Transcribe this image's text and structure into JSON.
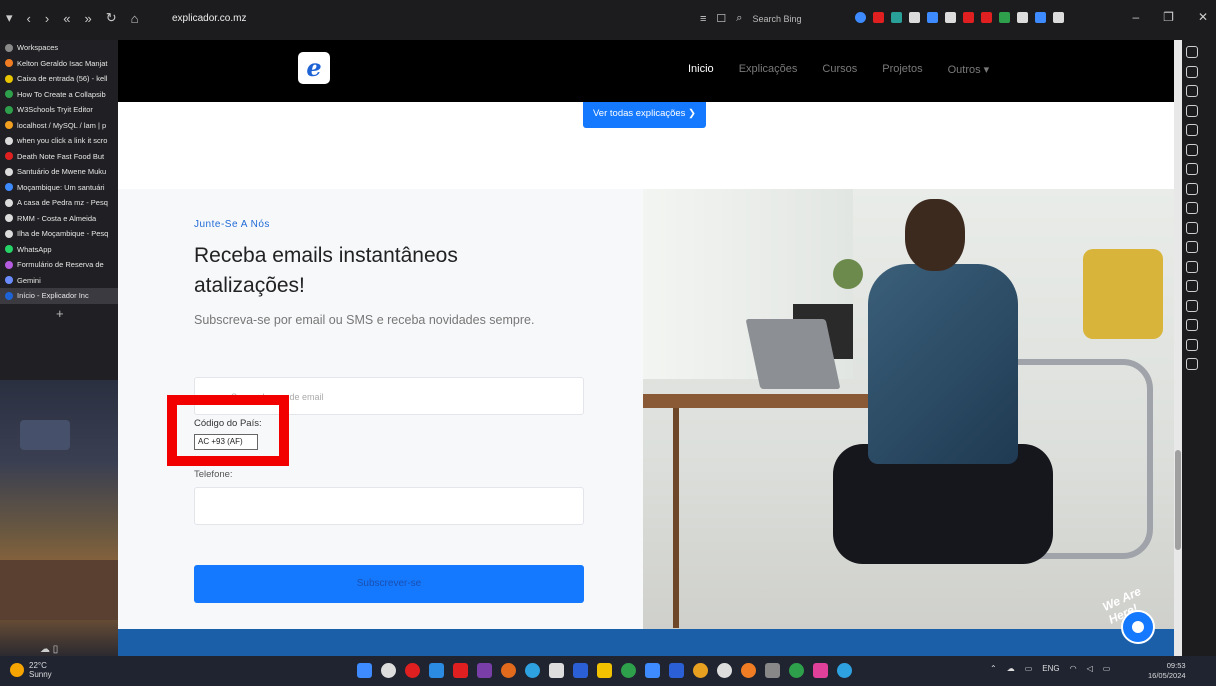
{
  "browser": {
    "url": "explicador.co.mz",
    "search_placeholder": "Search Bing"
  },
  "sidebar": {
    "items": [
      {
        "label": "Workspaces",
        "color": "#8a8a8a"
      },
      {
        "label": "Kelton Geraldo Isac Manjat",
        "color": "#f07d23"
      },
      {
        "label": "Caixa de entrada (56) - kell",
        "color": "#e8c500"
      },
      {
        "label": "How To Create a Collapsib",
        "color": "#2e9f4b"
      },
      {
        "label": "W3Schools Tryit Editor",
        "color": "#2e9f4b"
      },
      {
        "label": "localhost / MySQL / lam | p",
        "color": "#f3a020"
      },
      {
        "label": "when you click a link it scro",
        "color": "#dcdcdc"
      },
      {
        "label": "Death Note Fast Food But",
        "color": "#e02020"
      },
      {
        "label": "Santuário de Mwene Muku",
        "color": "#dcdcdc"
      },
      {
        "label": "Moçambique: Um santuári",
        "color": "#3d8bff"
      },
      {
        "label": "A casa de Pedra mz - Pesq",
        "color": "#dcdcdc"
      },
      {
        "label": "RMM - Costa e Almeida",
        "color": "#dcdcdc"
      },
      {
        "label": "Ilha de Moçambique - Pesq",
        "color": "#dcdcdc"
      },
      {
        "label": "WhatsApp",
        "color": "#25d366"
      },
      {
        "label": "Formulário de Reserva de",
        "color": "#b55be0"
      },
      {
        "label": "Gemini",
        "color": "#6b8cff"
      },
      {
        "label": "Início - Explicador Inc",
        "color": "#1e63d6"
      }
    ],
    "plus": "+"
  },
  "site": {
    "logo": "e",
    "nav": [
      {
        "label": "Inicio",
        "active": true
      },
      {
        "label": "Explicações",
        "active": false
      },
      {
        "label": "Cursos",
        "active": false
      },
      {
        "label": "Projetos",
        "active": false
      },
      {
        "label": "Outros ▾",
        "active": false
      }
    ],
    "view_all": "Ver todas explicações ❯"
  },
  "form": {
    "kicker": "Junte-Se A Nós",
    "heading": "Receba emails instantâneos atalizações!",
    "subtitle": "Subscreva-se por email ou SMS e receba novidades sempre.",
    "email_placeholder": "Seu endereço de email",
    "country_label": "Código do País:",
    "country_value": "AC +93 (AF)",
    "phone_label": "Telefone:",
    "subscribe": "Subscrever-se"
  },
  "chat": {
    "badge": "We Are Here!"
  },
  "taskbar": {
    "temperature": "22°C",
    "weather": "Sunny",
    "language": "ENG",
    "time": "09:53",
    "date": "16/05/2024"
  }
}
